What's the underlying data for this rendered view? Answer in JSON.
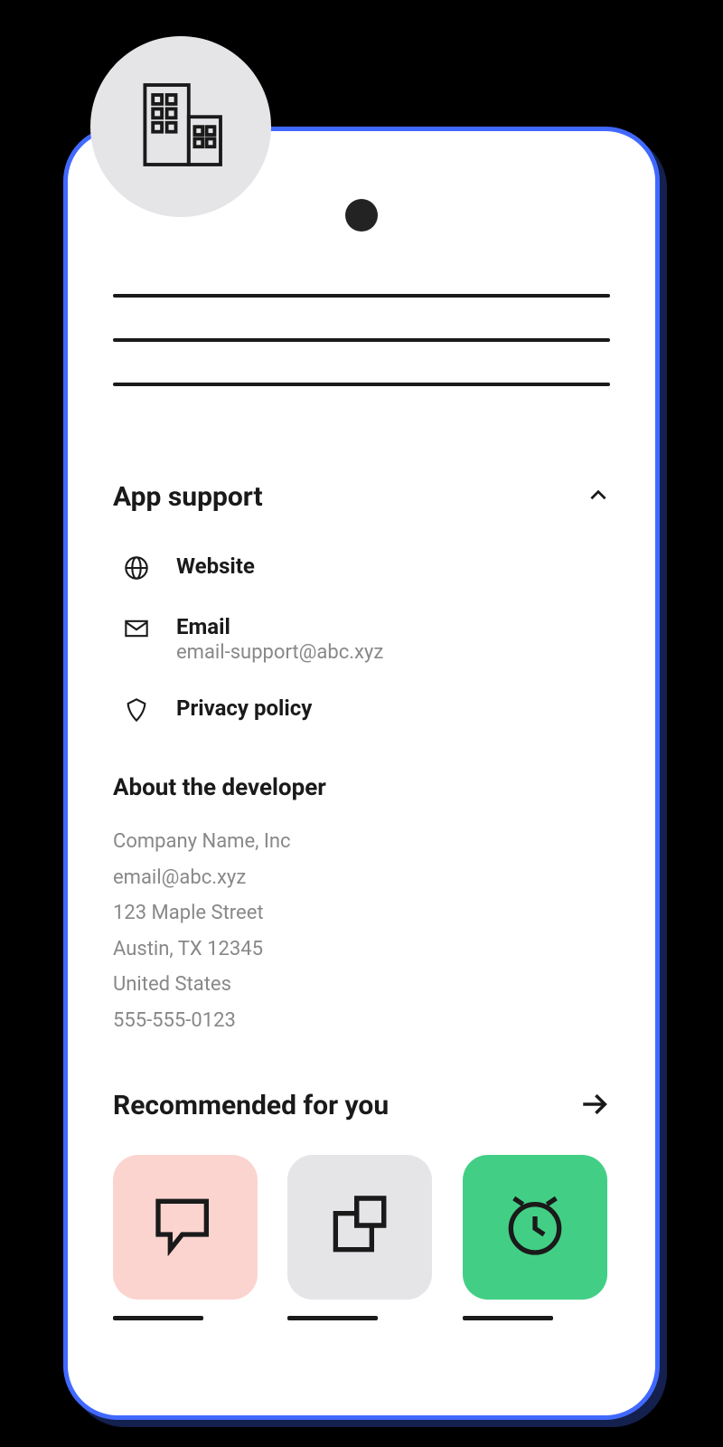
{
  "appSupport": {
    "title": "App support",
    "items": [
      {
        "label": "Website"
      },
      {
        "label": "Email",
        "sub": "email-support@abc.xyz"
      },
      {
        "label": "Privacy policy"
      }
    ]
  },
  "aboutDeveloper": {
    "title": "About the developer",
    "company": "Company Name, Inc",
    "email": "email@abc.xyz",
    "street": "123 Maple Street",
    "city": "Austin, TX 12345",
    "country": "United States",
    "phone": "555-555-0123"
  },
  "recommended": {
    "title": "Recommended for you",
    "apps": [
      {
        "icon": "chat-icon",
        "color": "pink"
      },
      {
        "icon": "copy-icon",
        "color": "grey"
      },
      {
        "icon": "alarm-icon",
        "color": "green"
      }
    ]
  }
}
